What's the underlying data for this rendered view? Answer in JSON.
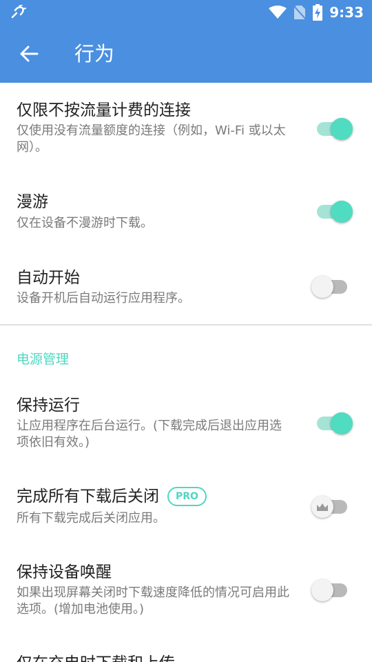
{
  "status_bar": {
    "time": "9:33",
    "left_icon": "link-icon",
    "icons": [
      "wifi-icon",
      "no-sim-icon",
      "battery-charging-icon"
    ]
  },
  "app_bar": {
    "back_icon": "arrow-back-icon",
    "title": "行为"
  },
  "settings": [
    {
      "title": "仅限不按流量计费的连接",
      "summary": "仅使用没有流量额度的连接（例如，Wi-Fi 或以太网）。",
      "enabled": true
    },
    {
      "title": "漫游",
      "summary": "仅在设备不漫游时下载。",
      "enabled": true
    },
    {
      "title": "自动开始",
      "summary": "设备开机后自动运行应用程序。",
      "enabled": false
    }
  ],
  "power_section": {
    "header": "电源管理",
    "items": [
      {
        "title": "保持运行",
        "summary": "让应用程序在后台运行。(下载完成后退出应用选项依旧有效。)",
        "enabled": true
      },
      {
        "title": "完成所有下载后关闭",
        "badge": "PRO",
        "summary": "所有下载完成后关闭应用。",
        "enabled": false,
        "locked_icon": "crown-icon"
      },
      {
        "title": "保持设备唤醒",
        "summary": "如果出现屏幕关闭时下载速度降低的情况可启用此选项。(增加电池使用。)",
        "enabled": false
      },
      {
        "title": "仅在充电时下载和上传",
        "summary": "",
        "enabled": false
      }
    ]
  },
  "colors": {
    "app_bar": "#4a8fe0",
    "accent": "#4fdcc0",
    "track_on": "#a5e3d7",
    "track_off": "#b9b9b9"
  }
}
